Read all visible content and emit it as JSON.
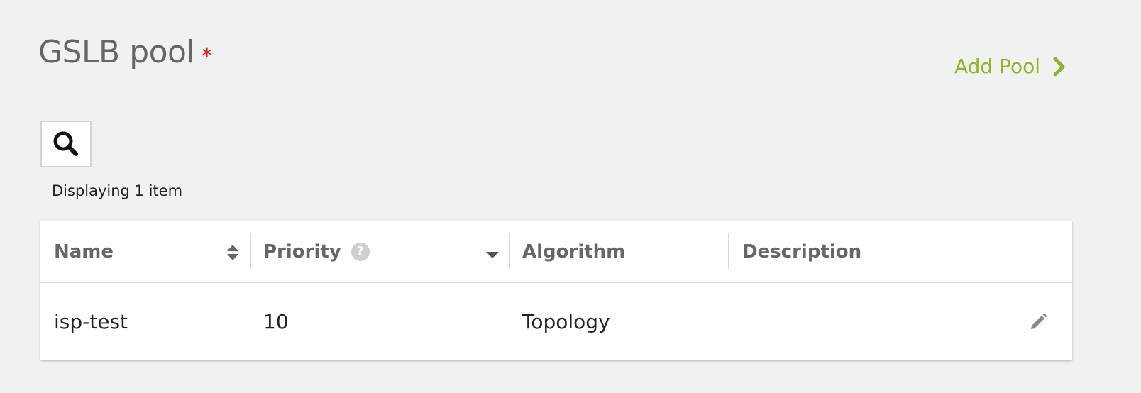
{
  "header": {
    "title": "GSLB pool",
    "required_marker": "*",
    "add_label": "Add Pool"
  },
  "search": {
    "icon": "search-icon"
  },
  "count_text": "Displaying 1 item",
  "table": {
    "columns": [
      {
        "label": "Name",
        "icon": "sort-icon"
      },
      {
        "label": "Priority",
        "icon": "help-icon",
        "sort_icon": "sort-desc-icon"
      },
      {
        "label": "Algorithm"
      },
      {
        "label": "Description"
      }
    ],
    "rows": [
      {
        "name": "isp-test",
        "priority": "10",
        "algorithm": "Topology",
        "description": "",
        "action_icon": "pencil-icon"
      }
    ],
    "help_glyph": "?"
  },
  "colors": {
    "accent": "#8db524",
    "required": "#e81818",
    "header_text": "#666666",
    "background": "#f1f1f1"
  }
}
